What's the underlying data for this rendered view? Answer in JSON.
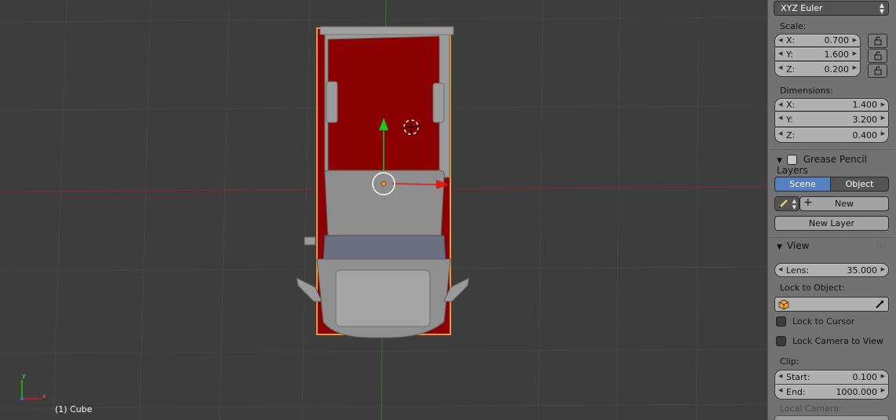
{
  "viewport": {
    "object_label": "(1) Cube",
    "axis_y": "y",
    "axis_x": "x"
  },
  "panel": {
    "rotation_mode": "XYZ Euler",
    "scale": {
      "label": "Scale:",
      "x_label": "X:",
      "x": "0.700",
      "y_label": "Y:",
      "y": "1.600",
      "z_label": "Z:",
      "z": "0.200"
    },
    "dimensions": {
      "label": "Dimensions:",
      "x_label": "X:",
      "x": "1.400",
      "y_label": "Y:",
      "y": "3.200",
      "z_label": "Z:",
      "z": "0.400"
    },
    "grease_pencil": {
      "title": "Grease Pencil Layers",
      "tab_scene": "Scene",
      "tab_object": "Object",
      "new_label": "New",
      "new_layer_label": "New Layer"
    },
    "view": {
      "title": "View",
      "lens_label": "Lens:",
      "lens": "35.000",
      "lock_to_object_label": "Lock to Object:",
      "lock_to_cursor": "Lock to Cursor",
      "lock_camera_to_view": "Lock Camera to View",
      "clip_label": "Clip:",
      "clip_start_label": "Start:",
      "clip_start": "0.100",
      "clip_end_label": "End:",
      "clip_end": "1000.000",
      "local_camera_label": "Local Camera:"
    }
  },
  "colors": {
    "viewport_bg": "#3d3d3d",
    "panel_bg": "#727272",
    "selected_tab": "#5680c2",
    "object_red": "#8b0000",
    "selection_outline": "#f0962a"
  }
}
